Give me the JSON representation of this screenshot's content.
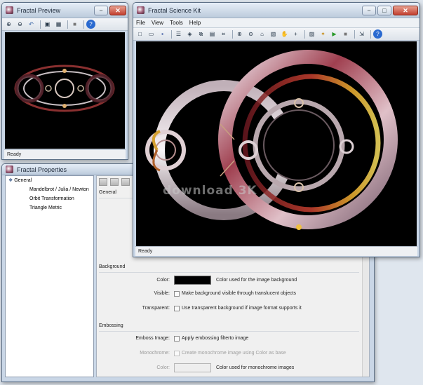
{
  "colors": {
    "desktop": "#dfe6ee",
    "title_gradient_top": "#e6eef8",
    "close_red": "#c24030",
    "canvas": "#000000",
    "background_swatch": "#000000",
    "monochrome_swatch": "#eeeeee"
  },
  "preview_window": {
    "title": "Fractal Preview",
    "controls": {
      "minimize": "−",
      "close": "✕"
    },
    "toolbar_icons": [
      "zoom-in-icon",
      "zoom-out-icon",
      "undo-icon",
      "fit-icon",
      "fit-window-icon",
      "stop-icon",
      "help-icon"
    ],
    "status": "Ready"
  },
  "main_window": {
    "title": "Fractal Science Kit",
    "controls": {
      "minimize": "−",
      "maximize": "□",
      "close": "✕"
    },
    "menu": [
      "File",
      "View",
      "Tools",
      "Help"
    ],
    "toolbar_icons": [
      "new-icon",
      "open-icon",
      "save-icon",
      "properties-icon",
      "gallery-icon",
      "copy-icon",
      "paste-icon",
      "crop-icon",
      "zoom-in-icon",
      "zoom-out-icon",
      "home-icon",
      "select-icon",
      "pan-icon",
      "crosshair-icon",
      "preview-icon",
      "wand-icon",
      "play-icon",
      "stop-icon",
      "export-icon",
      "help-icon"
    ],
    "status": "Ready"
  },
  "properties_window": {
    "title": "Fractal Properties",
    "tree": [
      {
        "label": "General",
        "selected": true,
        "level": 0
      },
      {
        "label": "Mandelbrot / Julia / Newton",
        "selected": false,
        "level": 1
      },
      {
        "label": "Orbit Transformation",
        "selected": false,
        "level": 1
      },
      {
        "label": "Triangle Metric",
        "selected": false,
        "level": 1
      }
    ],
    "panel_heading": "General",
    "background": {
      "heading": "Background",
      "color_label": "Color:",
      "color_desc": "Color used for the image background",
      "visible_label": "Visible:",
      "visible_text": "Make background visible through translucent objects",
      "visible_checked": false,
      "transparent_label": "Transparent:",
      "transparent_text": "Use transparent background if image format supports it",
      "transparent_checked": false
    },
    "embossing": {
      "heading": "Embossing",
      "emboss_label": "Emboss Image:",
      "emboss_text": "Apply embossing filterto image",
      "emboss_checked": false,
      "mono_label": "Monochrome:",
      "mono_text": "Create monochrome image using Color as base",
      "mono_color_label": "Color:",
      "mono_color_desc": "Color used for monochrome images"
    }
  },
  "watermark": "download 3K"
}
